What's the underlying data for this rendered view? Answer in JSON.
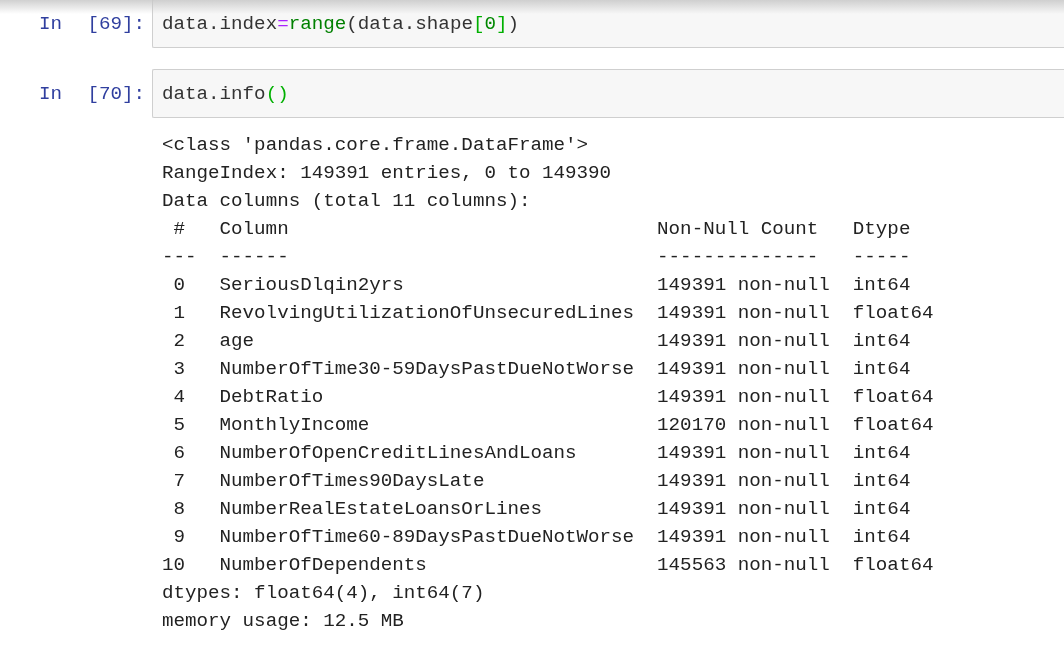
{
  "cells": [
    {
      "prompt": "In [69]:",
      "code": [
        {
          "text": "data.index",
          "kind": "plain"
        },
        {
          "text": "=",
          "kind": "operator"
        },
        {
          "text": "range",
          "kind": "builtin"
        },
        {
          "text": "(data.shape",
          "kind": "plain"
        },
        {
          "text": "[",
          "kind": "bracket"
        },
        {
          "text": "0",
          "kind": "number"
        },
        {
          "text": "]",
          "kind": "bracket"
        },
        {
          "text": ")",
          "kind": "plain"
        }
      ]
    },
    {
      "prompt": "In [70]:",
      "code": [
        {
          "text": "data.info",
          "kind": "plain"
        },
        {
          "text": "(",
          "kind": "bracket"
        },
        {
          "text": ")",
          "kind": "bracket"
        }
      ],
      "output": {
        "lines_before": [
          "<class 'pandas.core.frame.DataFrame'>",
          "RangeIndex: 149391 entries, 0 to 149390",
          "Data columns (total 11 columns):"
        ],
        "table": {
          "columns": [
            "#",
            "Column",
            "Non-Null Count",
            "Dtype"
          ],
          "separators": [
            "---",
            "------",
            "--------------",
            "-----"
          ],
          "rows": [
            [
              "0",
              "SeriousDlqin2yrs",
              "149391 non-null",
              "int64"
            ],
            [
              "1",
              "RevolvingUtilizationOfUnsecuredLines",
              "149391 non-null",
              "float64"
            ],
            [
              "2",
              "age",
              "149391 non-null",
              "int64"
            ],
            [
              "3",
              "NumberOfTime30-59DaysPastDueNotWorse",
              "149391 non-null",
              "int64"
            ],
            [
              "4",
              "DebtRatio",
              "149391 non-null",
              "float64"
            ],
            [
              "5",
              "MonthlyIncome",
              "120170 non-null",
              "float64"
            ],
            [
              "6",
              "NumberOfOpenCreditLinesAndLoans",
              "149391 non-null",
              "int64"
            ],
            [
              "7",
              "NumberOfTimes90DaysLate",
              "149391 non-null",
              "int64"
            ],
            [
              "8",
              "NumberRealEstateLoansOrLines",
              "149391 non-null",
              "int64"
            ],
            [
              "9",
              "NumberOfTime60-89DaysPastDueNotWorse",
              "149391 non-null",
              "int64"
            ],
            [
              "10",
              "NumberOfDependents",
              "145563 non-null",
              "float64"
            ]
          ]
        },
        "lines_after": [
          "dtypes: float64(4), int64(7)",
          "memory usage: 12.5 MB"
        ]
      }
    }
  ]
}
